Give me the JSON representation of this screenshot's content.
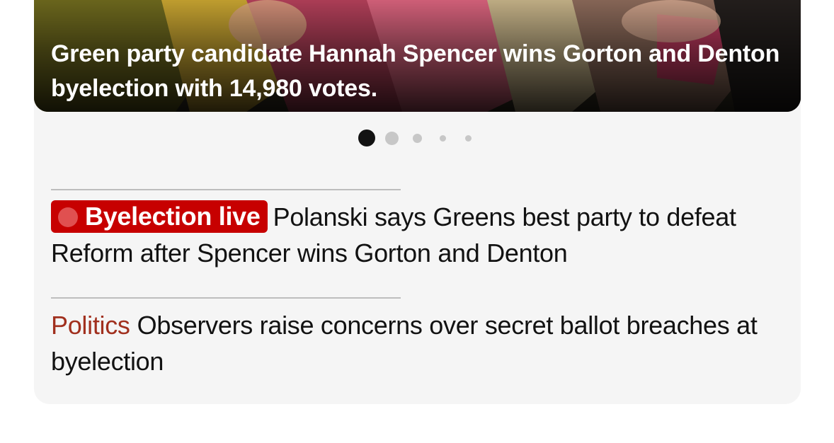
{
  "hero": {
    "caption": "Green party candidate Hannah Spencer wins Gorton and Denton byelection with 14,980 votes."
  },
  "carousel": {
    "total_slides": 5,
    "active_index": 0
  },
  "stories": [
    {
      "badge": "Byelection live",
      "headline": "Polanski says Greens best party to defeat Reform after Spencer wins Gorton and Denton"
    },
    {
      "kicker": "Politics",
      "headline": "Observers raise concerns over secret ballot breaches at byelection"
    }
  ],
  "colors": {
    "live_badge": "#c70000",
    "kicker": "#a1301e",
    "card_background": "#f5f5f5",
    "active_dot": "#121212",
    "inactive_dot": "#c7c7c7"
  }
}
